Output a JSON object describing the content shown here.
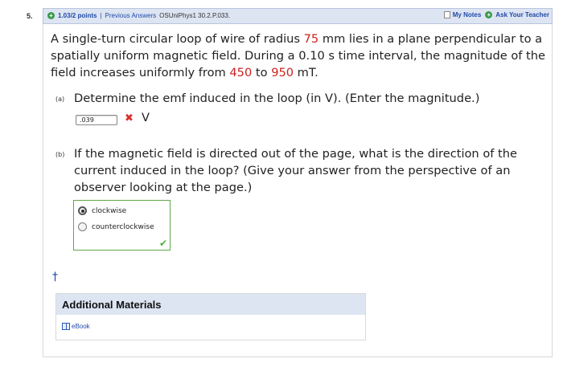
{
  "question_number": "5.",
  "header": {
    "points": "1.03/2 points",
    "separator": "|",
    "previous_answers": "Previous Answers",
    "problem_code": "OSUniPhys1 30.2.P.033.",
    "my_notes": "My Notes",
    "ask_teacher": "Ask Your Teacher"
  },
  "question": {
    "text_1": "A single-turn circular loop of wire of radius ",
    "radius": "75",
    "text_2": " mm lies in a plane perpendicular to a spatially uniform magnetic field. During a 0.10 s time interval, the magnitude of the field increases uniformly from ",
    "field_start": "450",
    "text_3": " to ",
    "field_end": "950",
    "text_4": " mT."
  },
  "part_a": {
    "label": "(a)",
    "text": "Determine the emf induced in the loop (in V). (Enter the magnitude.)",
    "answer_value": ".039",
    "unit": "V",
    "status_icon": "x-icon"
  },
  "part_b": {
    "label": "(b)",
    "text": "If the magnetic field is directed out of the page, what is the direction of the current induced in the loop? (Give your answer from the perspective of an observer looking at the page.)",
    "options": [
      "clockwise",
      "counterclockwise"
    ],
    "selected": "clockwise",
    "status_icon": "check-icon"
  },
  "dagger": "†",
  "additional_materials": {
    "title": "Additional Materials",
    "ebook_label": "eBook"
  },
  "colors": {
    "accent_blue": "#1f4aa8",
    "highlight_red": "#cc1e1e",
    "header_bg": "#dde4f2",
    "correct_green": "#4caf3a"
  }
}
